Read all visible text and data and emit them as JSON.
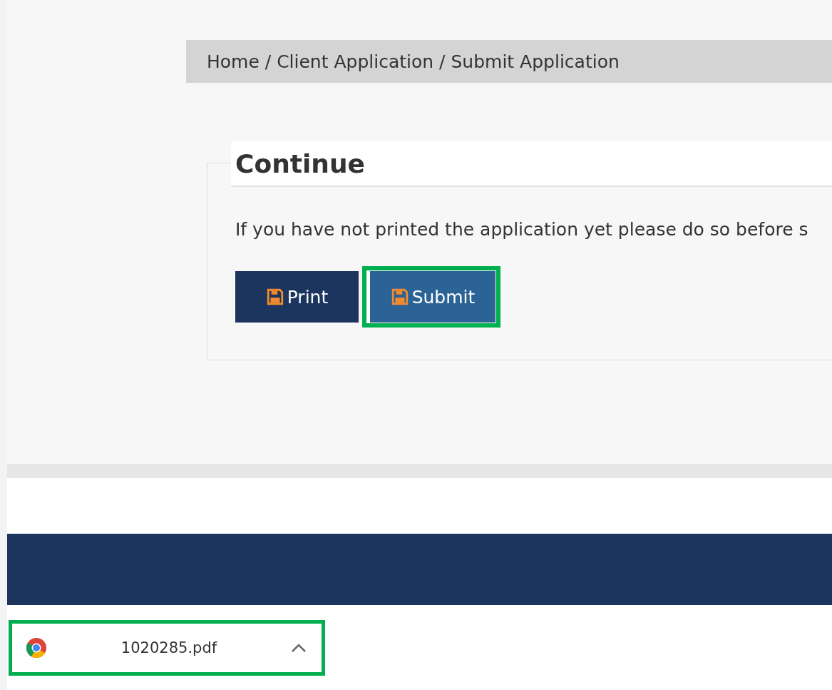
{
  "breadcrumb": "Home / Client Application / Submit Application",
  "section": {
    "title": "Continue",
    "message": "If you have not printed the application yet please do so before s",
    "buttons": [
      {
        "label": "Print",
        "highlighted": false
      },
      {
        "label": "Submit",
        "highlighted": true
      }
    ]
  },
  "download": {
    "filename": "1020285.pdf",
    "highlighted": true
  }
}
